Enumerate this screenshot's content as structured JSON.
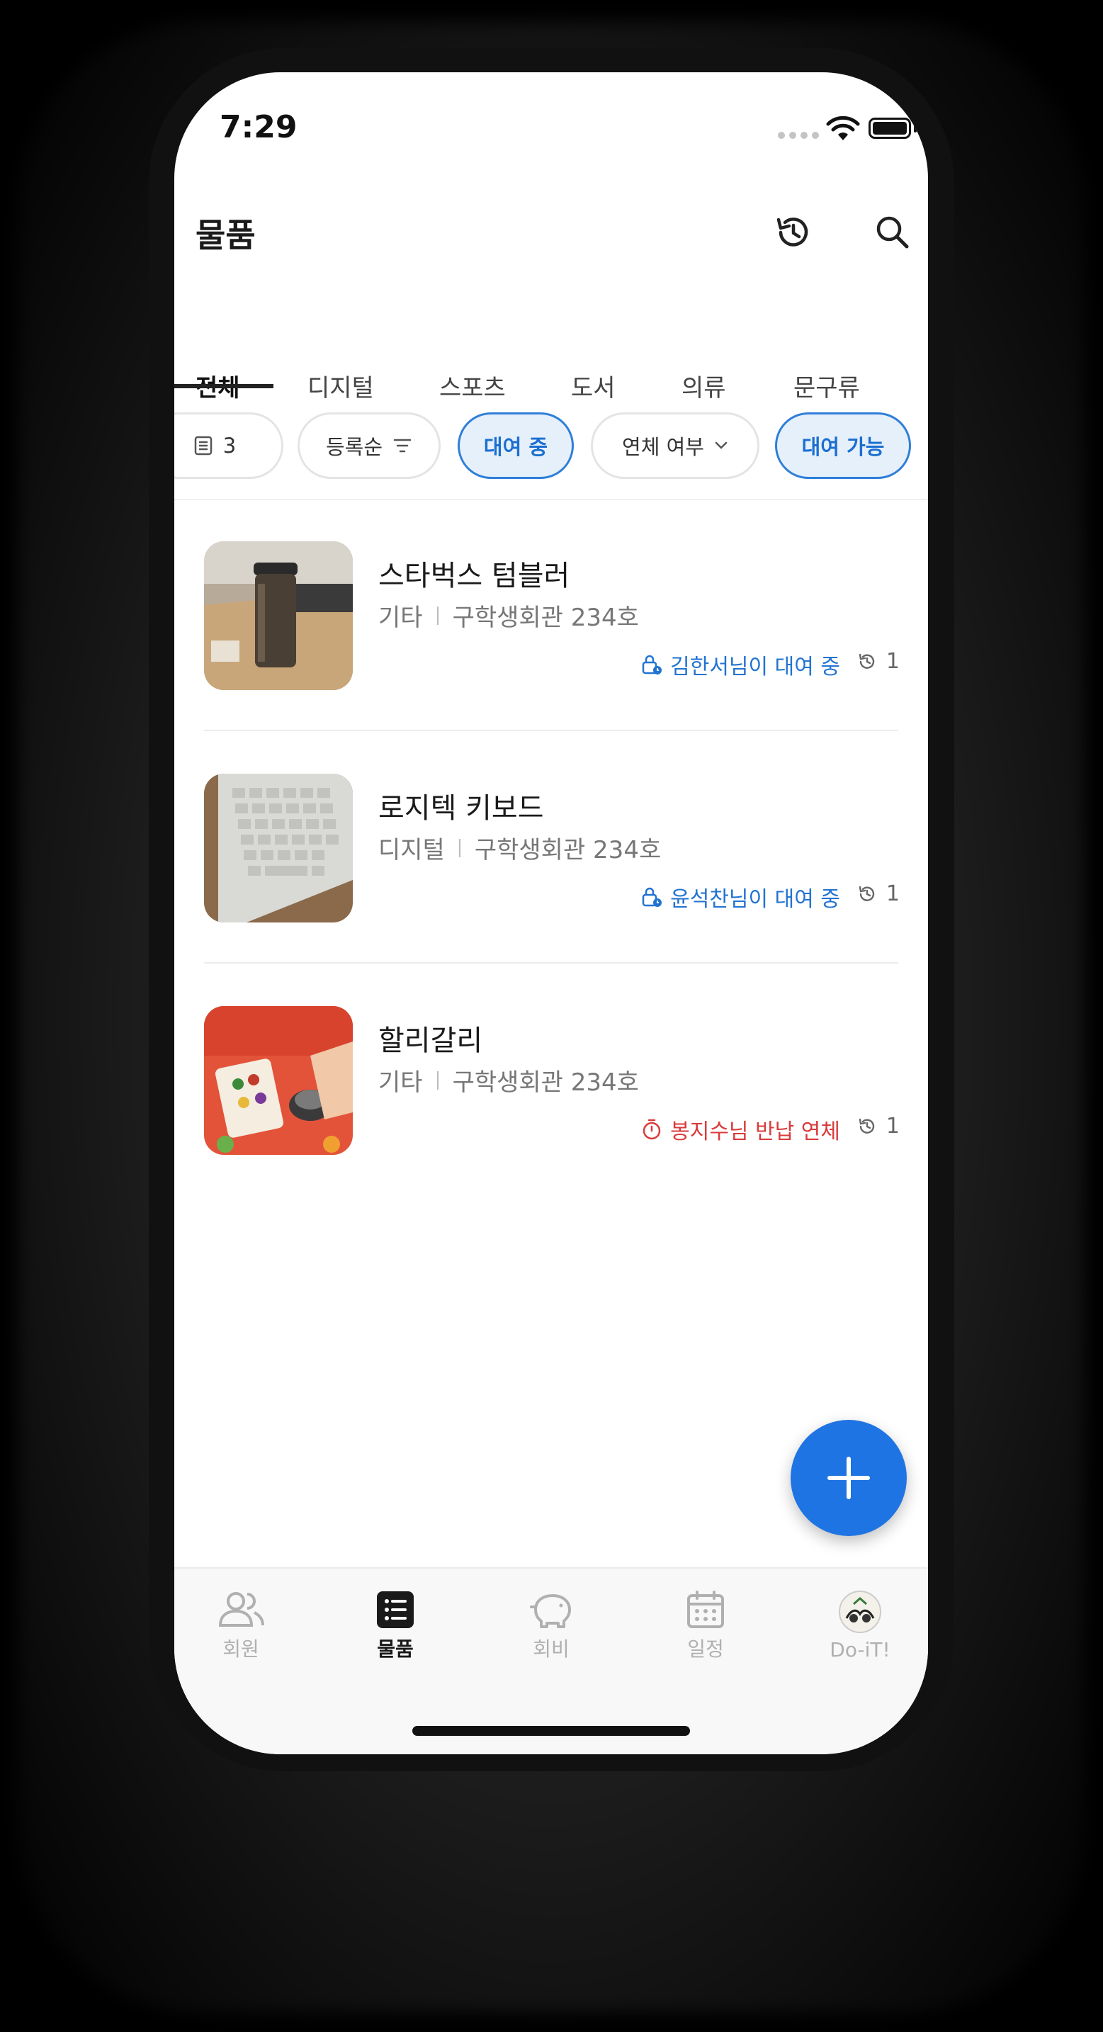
{
  "status_bar": {
    "time": "7:29"
  },
  "header": {
    "title": "물품",
    "history_icon": "history-icon",
    "search_icon": "search-icon"
  },
  "tabs": [
    {
      "label": "전체",
      "active": true
    },
    {
      "label": "디지털"
    },
    {
      "label": "스포츠"
    },
    {
      "label": "도서"
    },
    {
      "label": "의류"
    },
    {
      "label": "문구류"
    }
  ],
  "filters": {
    "count": "3",
    "sort_label": "등록순",
    "renting_label": "대여 중",
    "overdue_label": "연체 여부",
    "available_label": "대여 가능"
  },
  "items": [
    {
      "name": "스타벅스 텀블러",
      "category": "기타",
      "location": "구학생회관 234호",
      "status": "김한서님이 대여 중",
      "status_type": "renting",
      "history_count": "1"
    },
    {
      "name": "로지텍 키보드",
      "category": "디지털",
      "location": "구학생회관 234호",
      "status": "윤석찬님이 대여 중",
      "status_type": "renting",
      "history_count": "1"
    },
    {
      "name": "할리갈리",
      "category": "기타",
      "location": "구학생회관 234호",
      "status": "봉지수님 반납 연체",
      "status_type": "overdue",
      "history_count": "1"
    }
  ],
  "fab": {
    "icon": "plus-icon"
  },
  "bottom_nav": [
    {
      "label": "회원",
      "icon": "members-icon"
    },
    {
      "label": "물품",
      "icon": "list-icon",
      "active": true
    },
    {
      "label": "회비",
      "icon": "piggy-bank-icon"
    },
    {
      "label": "일정",
      "icon": "calendar-icon"
    },
    {
      "label": "Do-iT!",
      "icon": "club-logo-icon"
    }
  ],
  "colors": {
    "accent": "#1f74e3",
    "renting": "#2273d1",
    "overdue": "#d93b3b"
  }
}
